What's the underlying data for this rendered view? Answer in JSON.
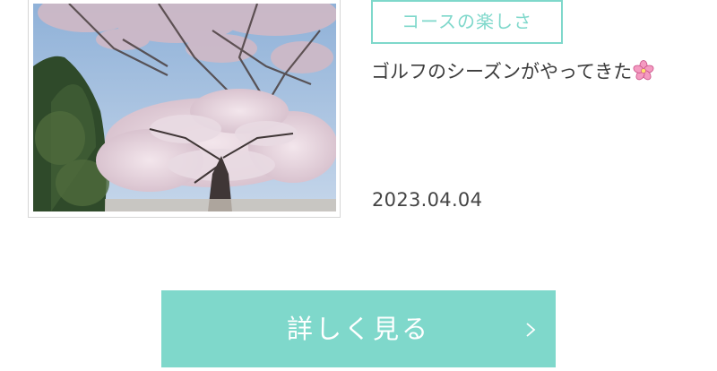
{
  "post": {
    "category": "コースの楽しさ",
    "title": "ゴルフのシーズンがやってきた",
    "title_emoji_icon": "cherry-blossom-icon",
    "date": "2023.04.04",
    "thumbnail_icon": "cherry-blossom-photo"
  },
  "button": {
    "label": "詳しく見る",
    "icon": "chevron-right-icon"
  },
  "colors": {
    "accent": "#7fd8cb",
    "text": "#3c3c3c",
    "frame": "#d6d6d6"
  }
}
